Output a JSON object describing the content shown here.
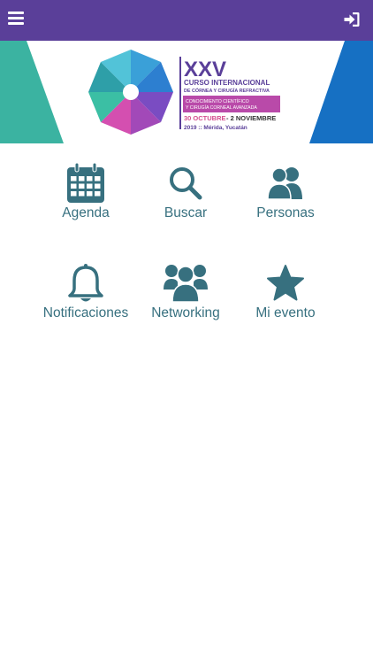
{
  "header": {
    "menu_icon": "hamburger-menu-icon",
    "login_icon": "sign-in-icon",
    "bar_color": "#5a3f99"
  },
  "banner": {
    "numeral": "XXV",
    "line1": "CURSO INTERNACIONAL",
    "line2": "DE CÓRNEA Y CIRUGÍA REFRACTIVA",
    "box1": "CONOCIMIENTO CIENTÍFICO",
    "box2": "Y CIRUGÍA CORNEAL AVANZADA",
    "date_start": "30 OCTUBRE",
    "date_end": "- 2 NOVIEMBRE",
    "place": "2019 :: Mérida, Yucatán"
  },
  "menu": {
    "icon_color": "#37707f",
    "items": [
      {
        "label": "Agenda",
        "icon": "calendar-icon"
      },
      {
        "label": "Buscar",
        "icon": "search-icon"
      },
      {
        "label": "Personas",
        "icon": "people-icon"
      },
      {
        "label": "Notificaciones",
        "icon": "bell-icon"
      },
      {
        "label": "Networking",
        "icon": "group-icon"
      },
      {
        "label": "Mi evento",
        "icon": "star-icon"
      }
    ]
  }
}
